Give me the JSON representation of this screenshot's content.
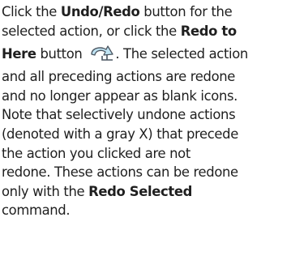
{
  "paragraph": {
    "l1_a": "Click the ",
    "l1_b": "Undo/Redo",
    "l1_c": " button for the",
    "l2_a": "selected action, or click the ",
    "l2_b": "Redo to",
    "l3_a": "Here",
    "l3_b": " button ",
    "l3_c": ". The selected action",
    "l4": "and all preceding actions are redone",
    "l5": "and no longer appear as blank icons.",
    "l6": "Note that selectively undone actions",
    "l7": "(denoted with a gray X) that precede",
    "l8": "the action you clicked are not",
    "l9": "redone. These actions can be redone",
    "l10_a": "only with the ",
    "l10_b": "Redo Selected",
    "l11": "command."
  },
  "icons": {
    "redo_to_here": "redo-to-here-icon"
  },
  "colors": {
    "text": "#1f1f1f",
    "icon_fill": "#bfe3f2",
    "icon_stroke": "#4a5560"
  }
}
